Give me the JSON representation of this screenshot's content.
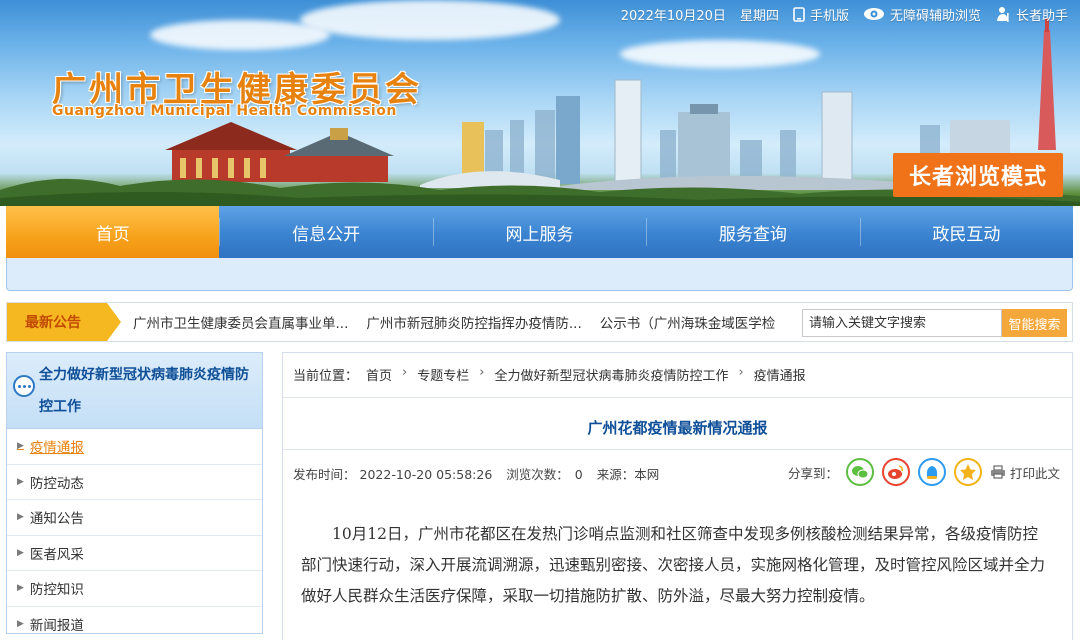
{
  "topbar": {
    "date": "2022年10月20日",
    "weekday": "星期四",
    "mobile": "手机版",
    "accessibility": "无障碍辅助浏览",
    "elder_assistant": "长者助手"
  },
  "header": {
    "logo_cn": "广州市卫生健康委员会",
    "logo_en": "Guangzhou Municipal Health Commission",
    "elder_mode": "长者浏览模式"
  },
  "nav": {
    "items": [
      {
        "label": "首页",
        "active": true
      },
      {
        "label": "信息公开"
      },
      {
        "label": "网上服务"
      },
      {
        "label": "服务查询"
      },
      {
        "label": "政民互动"
      }
    ]
  },
  "notice": {
    "label": "最新公告",
    "items": [
      "广州市卫生健康委员会直属事业单...",
      "广州市新冠肺炎防控指挥办疫情防...",
      "公示书（广州海珠金域医学检"
    ]
  },
  "search": {
    "placeholder": "请输入关键文字搜索",
    "button": "智能搜索"
  },
  "sidebar": {
    "title": "全力做好新型冠状病毒肺炎疫情防控工作",
    "items": [
      {
        "label": "疫情通报",
        "active": true
      },
      {
        "label": "防控动态"
      },
      {
        "label": "通知公告"
      },
      {
        "label": "医者风采"
      },
      {
        "label": "防控知识"
      },
      {
        "label": "新闻报道"
      }
    ]
  },
  "breadcrumb": {
    "prefix": "当前位置：",
    "items": [
      "首页",
      "专题专栏",
      "全力做好新型冠状病毒肺炎疫情防控工作",
      "疫情通报"
    ]
  },
  "article": {
    "title": "广州花都疫情最新情况通报",
    "publish_label": "发布时间：",
    "publish_time": "2022-10-20 05:58:26",
    "views_label": "浏览次数：",
    "views": "0",
    "source_label": "来源：",
    "source": "本网",
    "share_label": "分享到：",
    "print_label": "打印此文",
    "body": "10月12日，广州市花都区在发热门诊哨点监测和社区筛查中发现多例核酸检测结果异常，各级疫情防控部门快速行动，深入开展流调溯源，迅速甄别密接、次密接人员，实施网格化管理，及时管控风险区域并全力做好人民群众生活医疗保障，采取一切措施防扩散、防外溢，尽最大努力控制疫情。"
  },
  "colors": {
    "nav_blue": "#3a83d0",
    "nav_active": "#f7a21c",
    "elder_orange": "#f0731a",
    "title_blue": "#0f4f98",
    "accent_orange": "#e8820e"
  }
}
